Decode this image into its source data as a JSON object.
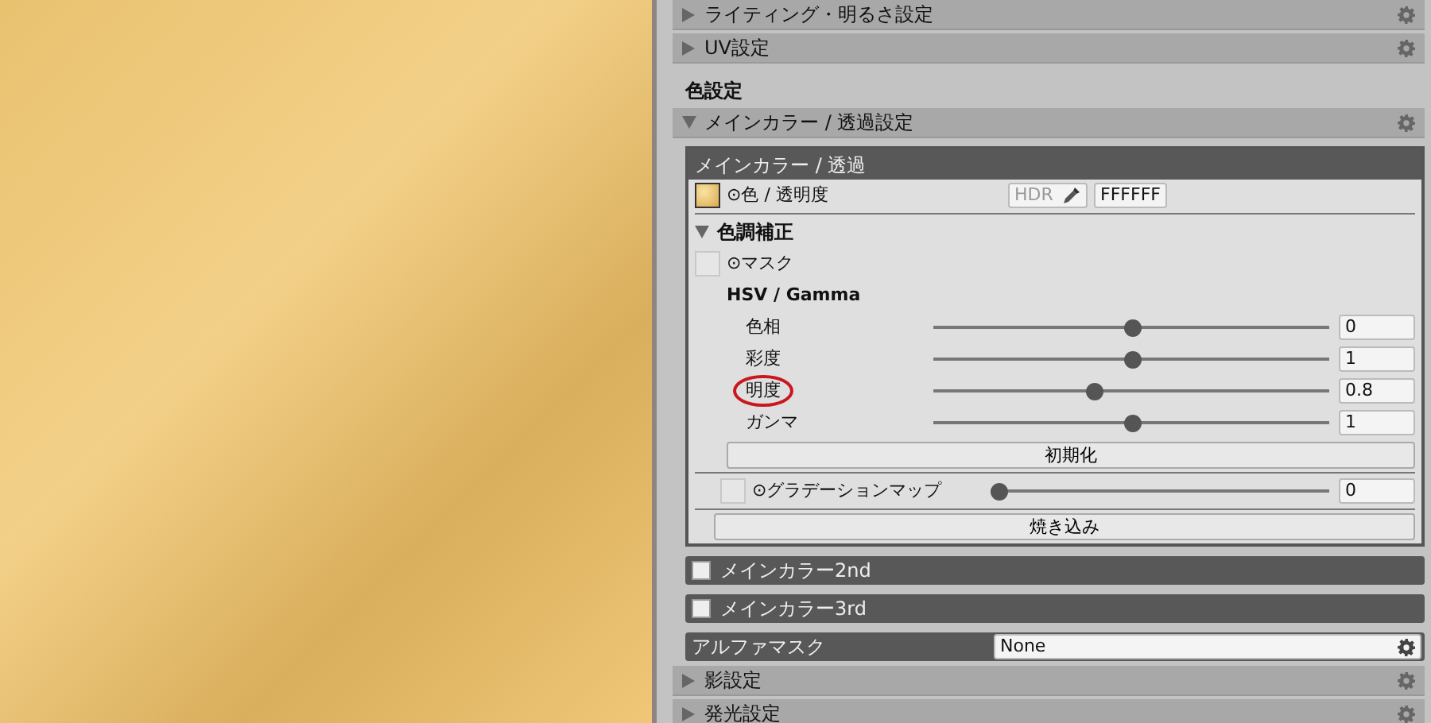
{
  "sections_top": [
    {
      "label": "ライティング・明るさ設定",
      "expanded": false
    },
    {
      "label": "UV設定",
      "expanded": false
    }
  ],
  "group_title": "色設定",
  "main_section": {
    "label": "メインカラー / 透過設定",
    "expanded": true
  },
  "panel": {
    "title": "メインカラー / 透過",
    "color_label": "⊙色 / 透明度",
    "hdr": "HDR",
    "hex": "FFFFFF",
    "adjust": {
      "label": "色調補正",
      "expanded": true
    },
    "mask_label": "⊙マスク",
    "hsv_title": "HSV / Gamma",
    "sliders": [
      {
        "label": "色相",
        "level": 0.5,
        "value": "0",
        "circled": false
      },
      {
        "label": "彩度",
        "level": 0.5,
        "value": "1",
        "circled": false
      },
      {
        "label": "明度",
        "level": 0.4,
        "value": "0.8",
        "circled": true
      },
      {
        "label": "ガンマ",
        "level": 0.5,
        "value": "1",
        "circled": false
      }
    ],
    "reset_button": "初期化",
    "gradient": {
      "label": "⊙グラデーションマップ",
      "level": 0,
      "value": "0"
    },
    "bake_button": "焼き込み"
  },
  "sub_sections": [
    {
      "label": "メインカラー2nd",
      "checked": false
    },
    {
      "label": "メインカラー3rd",
      "checked": false
    }
  ],
  "alpha_mask": {
    "label": "アルファマスク",
    "value": "None"
  },
  "sections_bottom": [
    {
      "label": "影設定",
      "expanded": false
    },
    {
      "label": "発光設定",
      "expanded": false
    }
  ]
}
